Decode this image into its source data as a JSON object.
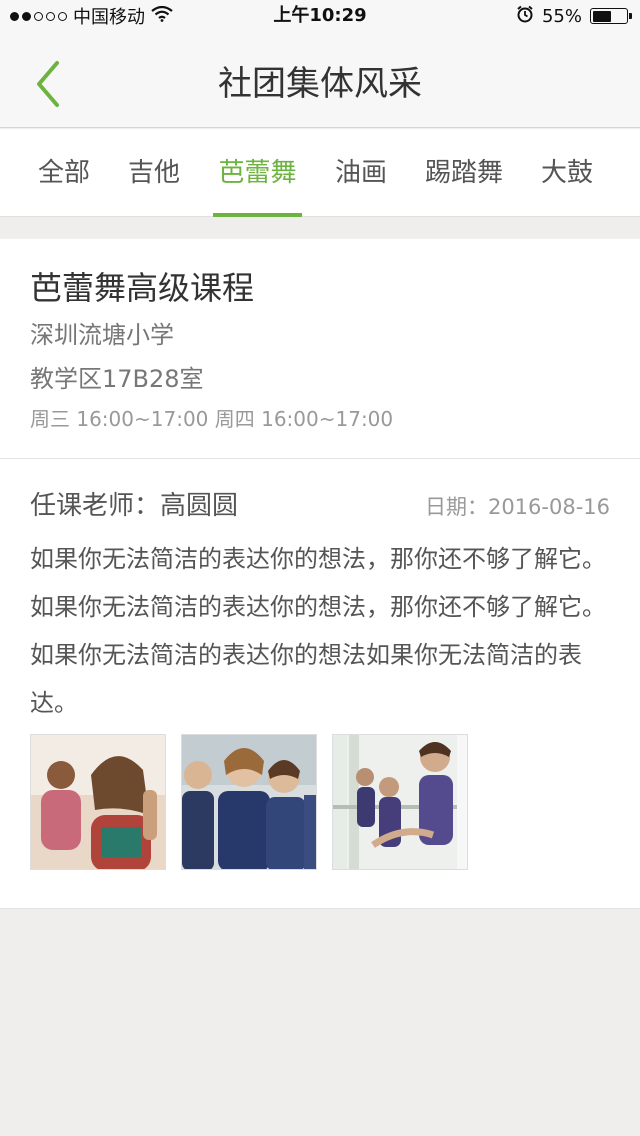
{
  "status_bar": {
    "carrier": "中国移动",
    "time": "上午10:29",
    "battery_percent": "55%",
    "battery_level": 0.55
  },
  "nav": {
    "title": "社团集体风采"
  },
  "tabs": [
    {
      "label": "全部"
    },
    {
      "label": "吉他"
    },
    {
      "label": "芭蕾舞",
      "active": true
    },
    {
      "label": "油画"
    },
    {
      "label": "踢踏舞"
    },
    {
      "label": "大鼓"
    }
  ],
  "course": {
    "title": "芭蕾舞高级课程",
    "school": "深圳流塘小学",
    "room": "教学区17B28室",
    "schedule": "周三 16:00~17:00  周四 16:00~17:00"
  },
  "post": {
    "teacher": "任课老师：高圆圆",
    "date": "日期：2016-08-16",
    "description": "如果你无法简洁的表达你的想法，那你还不够了解它。如果你无法简洁的表达你的想法，那你还不够了解它。如果你无法简洁的表达你的想法如果你无法简洁的表达。"
  },
  "colors": {
    "accent": "#6db33f",
    "background": "#efeeed"
  },
  "icons": {
    "back": "chevron-left-icon",
    "wifi": "wifi-icon",
    "alarm": "alarm-icon",
    "battery": "battery-icon"
  }
}
